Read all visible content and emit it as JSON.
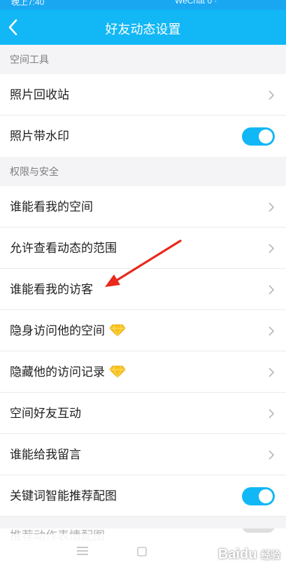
{
  "status_bar": {
    "left": "晚上7:40",
    "right": "WeChat 0 ·"
  },
  "header": {
    "title": "好友动态设置"
  },
  "sections": [
    {
      "title": "空间工具",
      "items": [
        {
          "label": "照片回收站",
          "control": "chevron"
        },
        {
          "label": "照片带水印",
          "control": "toggle",
          "on": true
        }
      ]
    },
    {
      "title": "权限与安全",
      "items": [
        {
          "label": "谁能看我的空间",
          "control": "chevron"
        },
        {
          "label": "允许查看动态的范围",
          "control": "chevron"
        },
        {
          "label": "谁能看我的访客",
          "control": "chevron"
        },
        {
          "label": "隐身访问他的空间",
          "control": "chevron",
          "badge": "diamond-icon"
        },
        {
          "label": "隐藏他的访问记录",
          "control": "chevron",
          "badge": "diamond-icon"
        },
        {
          "label": "空间好友互动",
          "control": "chevron"
        },
        {
          "label": "谁能给我留言",
          "control": "chevron"
        },
        {
          "label": "关键词智能推荐配图",
          "control": "toggle",
          "on": true
        }
      ]
    }
  ],
  "partial_row": {
    "label": "推荐动作表情配图"
  },
  "watermark": {
    "brand": "Baidu",
    "suffix": "经验"
  },
  "colors": {
    "header": "#12b7f5",
    "toggle_on": "#12b7f5",
    "annotation_arrow": "#e8291c",
    "vip_diamond": "#f7c21b"
  }
}
